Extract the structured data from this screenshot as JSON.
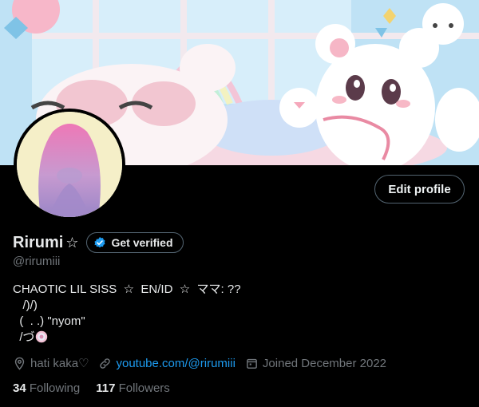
{
  "profile": {
    "name": "Rirumi",
    "name_suffix": "☆",
    "handle": "@rirumiii",
    "bio": "CHAOTIC LIL SISS  ☆  EN/ID  ☆  ママ: ??\n   /)/)\n  (  . .) \"nyom\"\n  /づ",
    "location": "hati kaka♡",
    "website": "youtube.com/@rirumiii",
    "joined": "Joined December 2022",
    "following_count": "34",
    "following_label": "Following",
    "followers_count": "117",
    "followers_label": "Followers"
  },
  "buttons": {
    "edit_profile": "Edit profile",
    "get_verified": "Get verified"
  },
  "colors": {
    "background": "#000000",
    "text_primary": "#e7e9ea",
    "text_secondary": "#71767b",
    "link": "#1d9bf0",
    "border": "#536471"
  }
}
